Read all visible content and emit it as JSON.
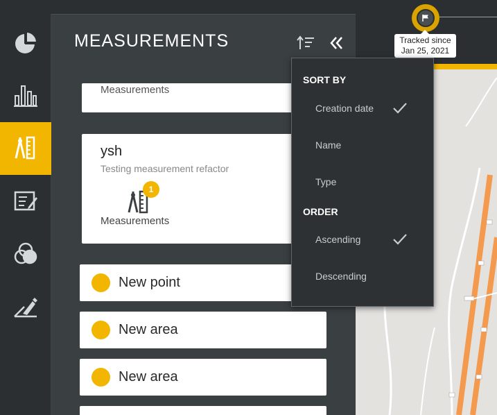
{
  "tracking": {
    "label_line1": "Tracked since",
    "label_line2": "Jan 25, 2021"
  },
  "rail": {
    "items": [
      {
        "icon": "pie-chart-icon",
        "active": false
      },
      {
        "icon": "bar-chart-icon",
        "active": false
      },
      {
        "icon": "measurement-tools-icon",
        "active": true
      },
      {
        "icon": "edit-report-icon",
        "active": false
      },
      {
        "icon": "layers-overlap-icon",
        "active": false
      },
      {
        "icon": "draw-shape-icon",
        "active": false
      }
    ]
  },
  "panel": {
    "title": "MEASUREMENTS",
    "top_card": {
      "caption": "Measurements"
    },
    "ysh_card": {
      "name": "ysh",
      "description": "Testing measurement refactor",
      "badge": "1",
      "caption": "Measurements"
    },
    "rows": [
      {
        "label": "New point"
      },
      {
        "label": "New area"
      },
      {
        "label": "New area"
      }
    ]
  },
  "sort_menu": {
    "sort_by_header": "SORT BY",
    "sort_options": [
      "Creation date",
      "Name",
      "Type"
    ],
    "sort_selected": "Creation date",
    "order_header": "ORDER",
    "order_options": [
      "Ascending",
      "Descending"
    ],
    "order_selected": "Ascending"
  },
  "colors": {
    "accent": "#f2b600",
    "background": "#2b2f31",
    "panel": "#3a3f42"
  }
}
